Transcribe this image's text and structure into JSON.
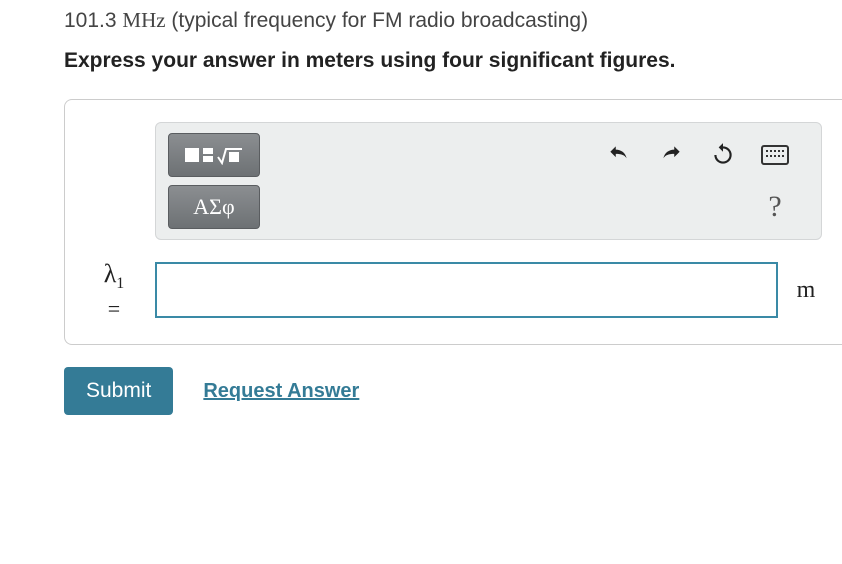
{
  "question": {
    "freq_value": "101.3",
    "freq_unit": "MHz",
    "paren": "(typical frequency for FM radio broadcasting)"
  },
  "instruction": "Express your answer in meters using four significant figures.",
  "toolbar": {
    "greek_label": "ΑΣφ"
  },
  "answer": {
    "var_symbol": "λ",
    "var_subscript": "1",
    "equals": "=",
    "value": "",
    "unit": "m"
  },
  "actions": {
    "submit": "Submit",
    "request": "Request Answer"
  }
}
